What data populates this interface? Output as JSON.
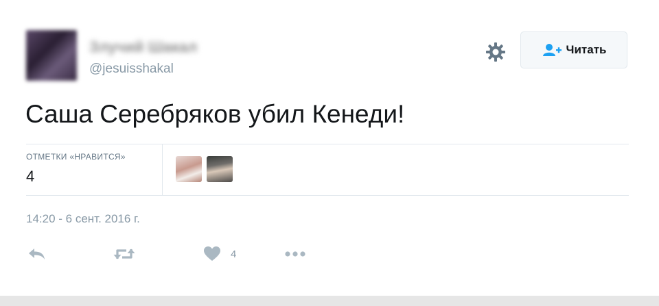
{
  "user": {
    "display_name": "Злучий Шакал",
    "handle": "@jesuisshakal"
  },
  "header": {
    "follow_label": "Читать"
  },
  "tweet": {
    "text": "Саша Серебряков убил Кенеди!",
    "likes_label": "ОТМЕТКИ «НРАВИТСЯ»",
    "likes_count": "4",
    "timestamp": "14:20 - 6 сент. 2016 г."
  },
  "actions": {
    "like_count": "4"
  },
  "icons": {
    "reply": "reply-icon",
    "retweet": "retweet-icon",
    "like": "heart-icon",
    "more": "more-icon",
    "settings": "gear-icon",
    "follow": "follow-user-icon"
  },
  "colors": {
    "accent": "#1da1f2",
    "muted": "#8899a6",
    "text": "#14171a",
    "divider": "#e1e8ed"
  }
}
